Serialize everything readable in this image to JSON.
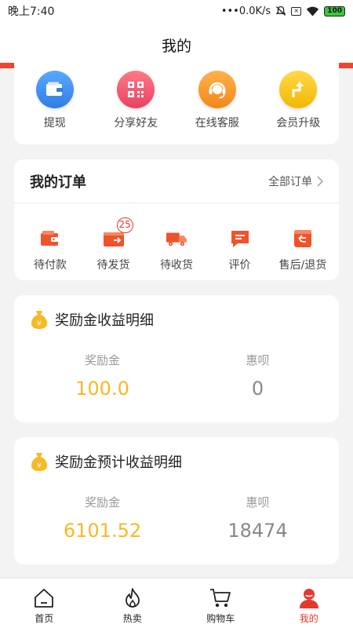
{
  "status_bar": {
    "time": "晚上7:40",
    "network_speed": "•••0.0K/s",
    "battery": "100"
  },
  "header": {
    "title": "我的"
  },
  "quick_actions": [
    {
      "label": "提现",
      "icon": "wallet-icon",
      "color": "#3a8ef0"
    },
    {
      "label": "分享好友",
      "icon": "qr-code-icon",
      "color": "#f05a6e"
    },
    {
      "label": "在线客服",
      "icon": "headset-icon",
      "color": "#f79a2a"
    },
    {
      "label": "会员升级",
      "icon": "upgrade-arrow-icon",
      "color": "#f5c400"
    }
  ],
  "orders": {
    "title": "我的订单",
    "all_label": "全部订单",
    "items": [
      {
        "label": "待付款",
        "icon": "wallet-icon",
        "badge": ""
      },
      {
        "label": "待发货",
        "icon": "package-icon",
        "badge": "25"
      },
      {
        "label": "待收货",
        "icon": "truck-icon",
        "badge": ""
      },
      {
        "label": "评价",
        "icon": "comment-icon",
        "badge": ""
      },
      {
        "label": "售后/退货",
        "icon": "return-icon",
        "badge": ""
      }
    ]
  },
  "reward_income": {
    "title": "奖励金收益明细",
    "col1_label": "奖励金",
    "col1_value": "100.0",
    "col2_label": "惠呗",
    "col2_value": "0"
  },
  "reward_forecast": {
    "title": "奖励金预计收益明细",
    "col1_label": "奖励金",
    "col1_value": "6101.52",
    "col2_label": "惠呗",
    "col2_value": "18474"
  },
  "tabbar": [
    {
      "label": "首页",
      "icon": "home-icon"
    },
    {
      "label": "热卖",
      "icon": "flame-icon"
    },
    {
      "label": "购物车",
      "icon": "cart-icon"
    },
    {
      "label": "我的",
      "icon": "user-icon",
      "active": true
    }
  ],
  "colors": {
    "accent": "#e23b2e",
    "gold": "#f7b924",
    "order_icon": "#f0532b"
  }
}
